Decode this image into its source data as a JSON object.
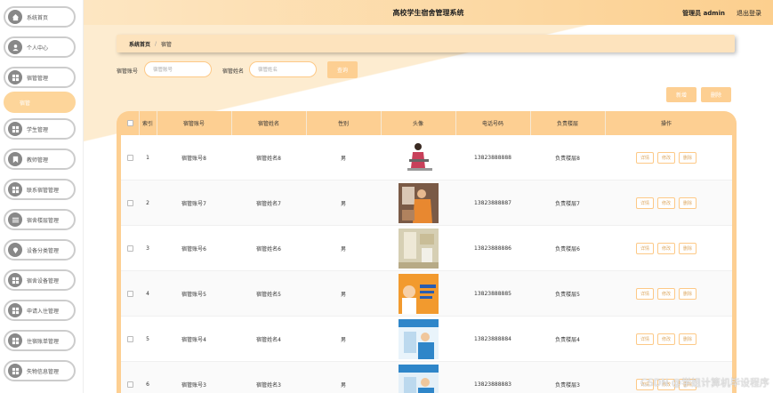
{
  "header": {
    "title": "高校学生宿舍管理系统",
    "admin_text": "管理员 admin",
    "logout": "退出登录"
  },
  "sidebar": {
    "items": [
      {
        "label": "系统首页",
        "icon": "home-icon"
      },
      {
        "label": "个人中心",
        "icon": "user-icon"
      },
      {
        "label": "宿管管理",
        "icon": "grid-icon"
      },
      {
        "label": "宿管",
        "icon": "",
        "active": true
      },
      {
        "label": "学生管理",
        "icon": "grid-icon"
      },
      {
        "label": "教师管理",
        "icon": "bookmark-icon"
      },
      {
        "label": "联系宿管管理",
        "icon": "grid-icon"
      },
      {
        "label": "宿舍楼层管理",
        "icon": "list-icon"
      },
      {
        "label": "设备分类管理",
        "icon": "pin-icon"
      },
      {
        "label": "宿舍设备管理",
        "icon": "grid-icon"
      },
      {
        "label": "申请入住管理",
        "icon": "grid-icon"
      },
      {
        "label": "住宿账单管理",
        "icon": "grid-icon"
      },
      {
        "label": "失物信息管理",
        "icon": "grid-icon"
      }
    ]
  },
  "breadcrumb": {
    "home": "系统首页",
    "sep": "/",
    "current": "宿管"
  },
  "search": {
    "account_label": "宿管账号",
    "account_placeholder": "宿管账号",
    "name_label": "宿管姓名",
    "name_placeholder": "宿管姓名",
    "query_button": "查询"
  },
  "actions": {
    "add": "新增",
    "delete": "删除"
  },
  "table": {
    "headers": [
      "索引",
      "宿管账号",
      "宿管姓名",
      "性别",
      "头像",
      "电话号码",
      "负责楼层",
      "操作"
    ],
    "row_actions": [
      "详情",
      "修改",
      "删除"
    ],
    "rows": [
      {
        "index": "1",
        "account": "宿管账号8",
        "name": "宿管姓名8",
        "gender": "男",
        "phone": "13823888888",
        "floor": "负责楼层8",
        "photo": "person-ironing"
      },
      {
        "index": "2",
        "account": "宿管账号7",
        "name": "宿管姓名7",
        "gender": "男",
        "phone": "13823888887",
        "floor": "负责楼层7",
        "photo": "person-cleaning"
      },
      {
        "index": "3",
        "account": "宿管账号6",
        "name": "宿管姓名6",
        "gender": "男",
        "phone": "13823888886",
        "floor": "负责楼层6",
        "photo": "bathroom"
      },
      {
        "index": "4",
        "account": "宿管账号5",
        "name": "宿管姓名5",
        "gender": "男",
        "phone": "13823888885",
        "floor": "负责楼层5",
        "photo": "cleaning-poster"
      },
      {
        "index": "5",
        "account": "宿管账号4",
        "name": "宿管姓名4",
        "gender": "男",
        "phone": "13823888884",
        "floor": "负责楼层4",
        "photo": "appliance-service"
      },
      {
        "index": "6",
        "account": "宿管账号3",
        "name": "宿管姓名3",
        "gender": "男",
        "phone": "13823888883",
        "floor": "负责楼层3",
        "photo": "appliance-service-2"
      }
    ]
  },
  "watermark": "CSDN @学姐计算机毕设程序",
  "colors": {
    "accent": "#fdcf92",
    "header_start": "#fde6c2",
    "header_end": "#fccf8e",
    "icon_gray": "#888888"
  }
}
